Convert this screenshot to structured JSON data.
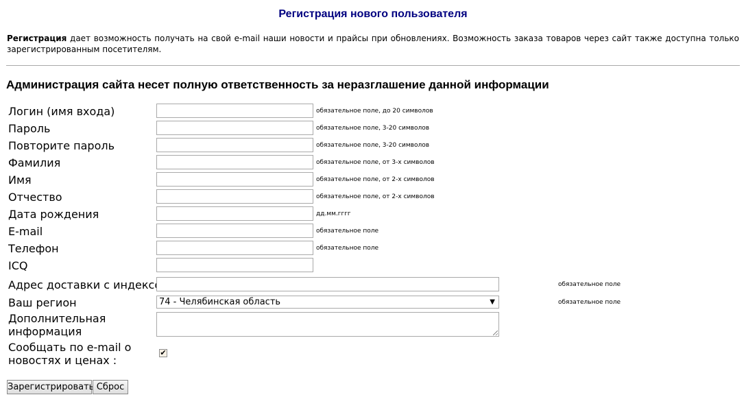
{
  "page": {
    "title": "Регистрация нового пользователя",
    "intro_bold": "Регистрация",
    "intro_text": " дает возможность получать на свой e-mail наши новости и прайсы при обновлениях. Возможность заказа товаров через сайт также доступна только зарегистрированным посетителям.",
    "section_heading": "Администрация сайта несет полную ответственность за неразглашение данной информации"
  },
  "form": {
    "login": {
      "label": "Логин (имя входа)",
      "value": "",
      "hint": "обязательное поле, до 20 символов"
    },
    "password": {
      "label": "Пароль",
      "value": "",
      "hint": "обязательное поле, 3-20 символов"
    },
    "password_repeat": {
      "label": "Повторите пароль",
      "value": "",
      "hint": "обязательное поле, 3-20 символов"
    },
    "surname": {
      "label": "Фамилия",
      "value": "",
      "hint": "обязательное поле, от 3-х символов"
    },
    "first_name": {
      "label": "Имя",
      "value": "",
      "hint": "обязательное поле, от 2-х символов"
    },
    "patronymic": {
      "label": "Отчество",
      "value": "",
      "hint": "обязательное поле, от 2-х символов"
    },
    "birth_date": {
      "label": "Дата рождения",
      "value": "",
      "hint": "дд.мм.гггг"
    },
    "email": {
      "label": "E-mail",
      "value": "",
      "hint": "обязательное поле"
    },
    "phone": {
      "label": "Телефон",
      "value": "",
      "hint": "обязательное поле"
    },
    "icq": {
      "label": "ICQ",
      "value": ""
    },
    "address": {
      "label": "Адрес доставки с индексом",
      "value": "",
      "hint": "обязательное поле"
    },
    "region": {
      "label": "Ваш регион",
      "selected": "74 - Челябинская область",
      "hint": "обязательное поле"
    },
    "additional": {
      "label_line1": "Дополнительная",
      "label_line2": "информация",
      "value": ""
    },
    "subscribe": {
      "label_line1": "Сообщать по e-mail о",
      "label_line2": "новостях и ценах :",
      "checked": true,
      "check_glyph": "✔"
    }
  },
  "buttons": {
    "register": "Зарегистрировать",
    "reset": "Сброс"
  },
  "icons": {
    "dropdown": "chevron-down-icon",
    "checkmark": "checkmark-icon"
  },
  "colors": {
    "title": "#000080",
    "divider": "#a8a8a8"
  }
}
